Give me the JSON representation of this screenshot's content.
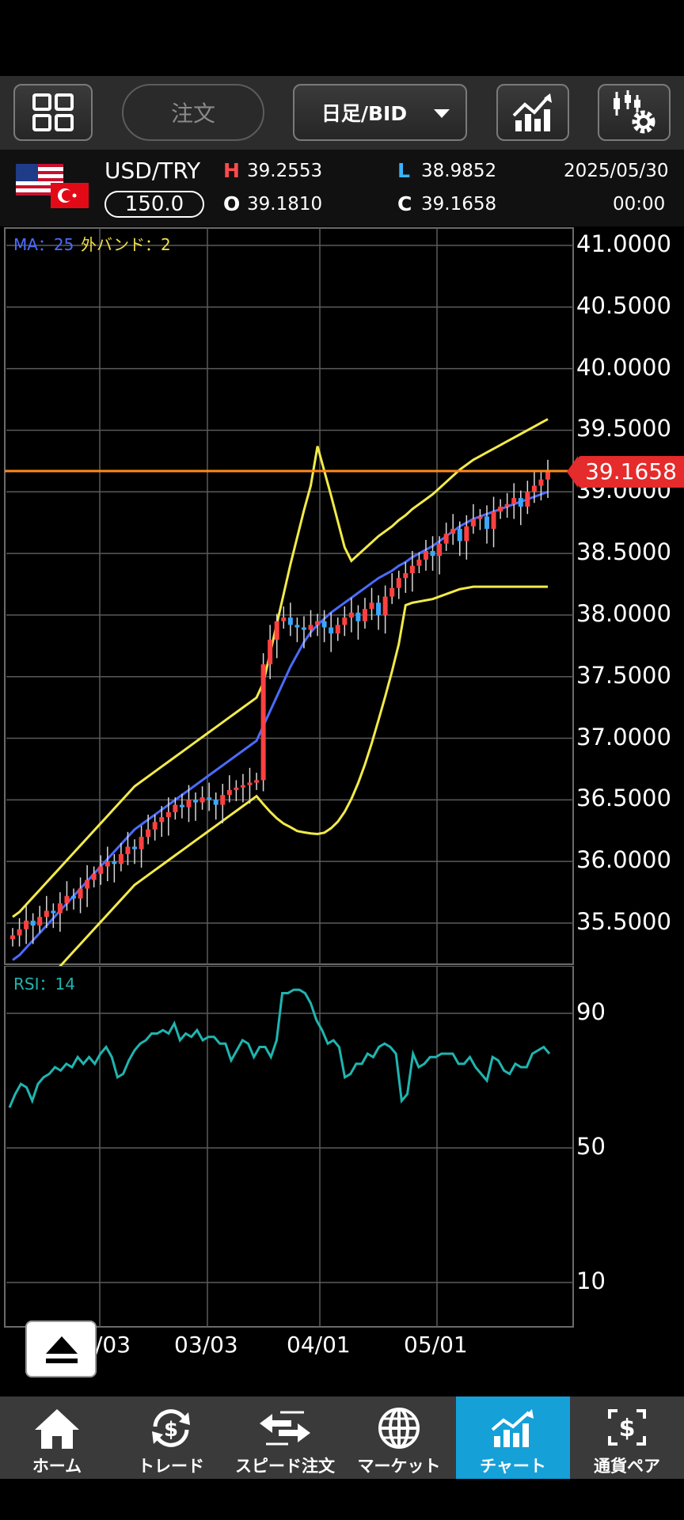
{
  "toolbar": {
    "order_label": "注文",
    "period_label": "日足/BID",
    "icons": [
      "grid-icon",
      "chart-type-icon",
      "indicator-settings-icon"
    ]
  },
  "quote": {
    "pair": "USD/TRY",
    "spread": "150.0",
    "high_label": "H",
    "high": "39.2553",
    "low_label": "L",
    "low": "38.9852",
    "open_label": "O",
    "open": "39.1810",
    "close_label": "C",
    "close": "39.1658",
    "date": "2025/05/30",
    "time": "00:00"
  },
  "chart_data": {
    "type": "candlestick",
    "indicator_label_ma": "MA：25",
    "indicator_label_band": "外バンド：2",
    "rsi_label": "RSI：14",
    "last_price": "39.1658",
    "price_axis": [
      "41.0000",
      "40.5000",
      "40.0000",
      "39.5000",
      "39.0000",
      "38.5000",
      "38.0000",
      "37.5000",
      "37.0000",
      "36.5000",
      "36.0000",
      "35.5000"
    ],
    "rsi_axis": [
      "90",
      "50",
      "10"
    ],
    "time_axis": [
      "/03",
      "03/03",
      "04/01",
      "05/01"
    ],
    "ylim": [
      35.2,
      41.1
    ],
    "rsi_lim": [
      0,
      100
    ],
    "closes": [
      35.4,
      35.45,
      35.52,
      35.48,
      35.55,
      35.6,
      35.58,
      35.66,
      35.72,
      35.7,
      35.78,
      35.85,
      35.9,
      35.96,
      36.0,
      35.98,
      36.06,
      36.12,
      36.1,
      36.2,
      36.26,
      36.32,
      36.36,
      36.4,
      36.46,
      36.44,
      36.5,
      36.48,
      36.52,
      36.5,
      36.46,
      36.54,
      36.58,
      36.6,
      36.62,
      36.64,
      36.66,
      37.6,
      37.8,
      37.95,
      37.98,
      37.92,
      37.9,
      37.88,
      37.92,
      37.95,
      37.9,
      37.85,
      37.92,
      37.98,
      38.02,
      37.95,
      38.05,
      38.1,
      38.0,
      38.15,
      38.22,
      38.3,
      38.34,
      38.4,
      38.45,
      38.52,
      38.48,
      38.58,
      38.66,
      38.7,
      38.6,
      38.72,
      38.78,
      38.8,
      38.7,
      38.84,
      38.88,
      38.9,
      38.95,
      38.88,
      39.0,
      39.05,
      39.1,
      39.17
    ],
    "ma": [
      35.2,
      35.24,
      35.3,
      35.36,
      35.42,
      35.48,
      35.54,
      35.6,
      35.66,
      35.72,
      35.78,
      35.84,
      35.9,
      35.96,
      36.02,
      36.08,
      36.14,
      36.2,
      36.26,
      36.3,
      36.34,
      36.38,
      36.42,
      36.46,
      36.5,
      36.54,
      36.58,
      36.62,
      36.66,
      36.7,
      36.74,
      36.78,
      36.82,
      36.86,
      36.9,
      36.94,
      36.98,
      37.1,
      37.22,
      37.34,
      37.46,
      37.58,
      37.68,
      37.78,
      37.86,
      37.92,
      37.97,
      38.02,
      38.06,
      38.1,
      38.14,
      38.18,
      38.22,
      38.26,
      38.3,
      38.33,
      38.36,
      38.4,
      38.43,
      38.47,
      38.5,
      38.53,
      38.56,
      38.6,
      38.64,
      38.68,
      38.72,
      38.75,
      38.78,
      38.8,
      38.82,
      38.84,
      38.86,
      38.88,
      38.9,
      38.92,
      38.94,
      38.96,
      38.98,
      39.0
    ],
    "rsi": [
      62,
      66,
      69,
      68,
      64,
      69,
      71,
      72,
      74,
      73,
      75,
      74,
      77,
      75,
      77,
      75,
      78,
      80,
      77,
      71,
      72,
      76,
      79,
      81,
      82,
      84,
      84,
      85,
      84,
      87,
      82,
      84,
      83,
      85,
      82,
      83,
      83,
      81,
      81,
      76,
      79,
      82,
      81,
      77,
      80,
      80,
      77,
      82,
      96,
      96,
      97,
      97,
      96,
      93,
      88,
      85,
      81,
      82,
      80,
      71,
      72,
      75,
      75,
      78,
      77,
      80,
      81,
      80,
      78,
      64,
      66,
      78,
      74,
      75,
      77,
      77,
      78,
      78,
      78,
      75,
      75,
      77,
      74,
      72,
      70,
      77,
      76,
      73,
      72,
      75,
      74,
      74,
      78,
      79,
      80,
      78
    ]
  },
  "nav": [
    {
      "label": "ホーム",
      "icon": "home-icon"
    },
    {
      "label": "トレード",
      "icon": "trade-icon"
    },
    {
      "label": "スピード注文",
      "icon": "speed-order-icon"
    },
    {
      "label": "マーケット",
      "icon": "market-icon"
    },
    {
      "label": "チャート",
      "icon": "chart-icon"
    },
    {
      "label": "通貨ペア",
      "icon": "currency-pair-icon"
    }
  ]
}
